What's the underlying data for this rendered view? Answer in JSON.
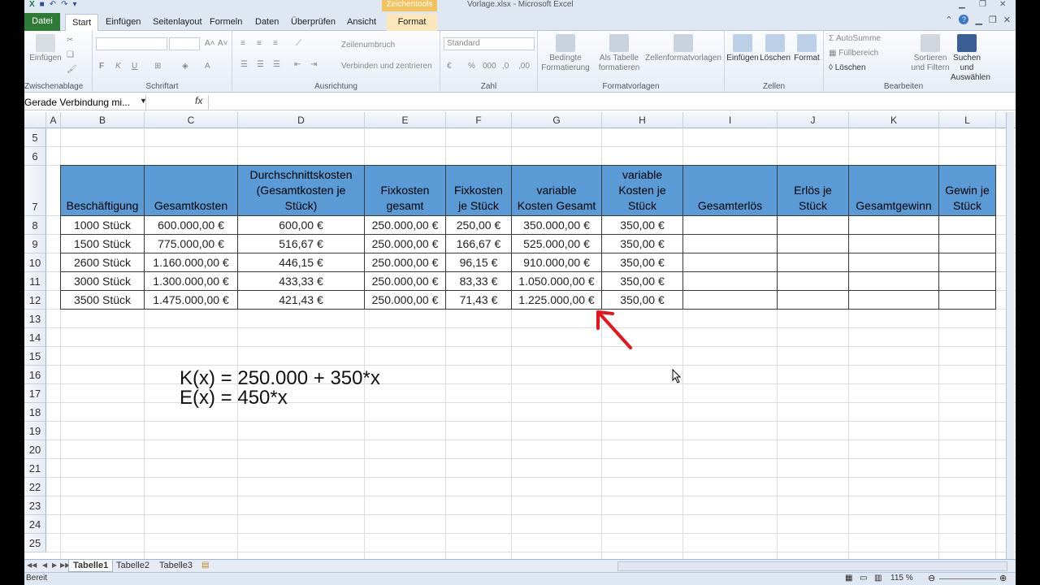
{
  "window": {
    "title": "Vorlage.xlsx - Microsoft Excel",
    "context_tab_group": "Zeichentools"
  },
  "tabs": {
    "file": "Datei",
    "start": "Start",
    "insert": "Einfügen",
    "page_layout": "Seitenlayout",
    "formulas": "Formeln",
    "data": "Daten",
    "review": "Überprüfen",
    "view": "Ansicht",
    "format": "Format"
  },
  "ribbon": {
    "clipboard": {
      "label": "Zwischenablage",
      "paste": "Einfügen"
    },
    "font": {
      "label": "Schriftart",
      "bold": "F",
      "italic": "K",
      "underline": "U"
    },
    "alignment": {
      "label": "Ausrichtung",
      "wrap": "Zeilenumbruch",
      "merge": "Verbinden und zentrieren"
    },
    "number": {
      "label": "Zahl",
      "format": "Standard",
      "percent": "%",
      "thousands": "000"
    },
    "styles": {
      "label": "Formatvorlagen",
      "conditional": "Bedingte Formatierung",
      "as_table": "Als Tabelle formatieren",
      "cell_styles": "Zellenformatvorlagen"
    },
    "cells": {
      "label": "Zellen",
      "insert": "Einfügen",
      "delete": "Löschen",
      "format": "Format"
    },
    "editing": {
      "label": "Bearbeiten",
      "autosum": "AutoSumme",
      "fill": "Füllbereich",
      "clear": "Löschen",
      "sort": "Sortieren und Filtern",
      "find": "Suchen und Auswählen"
    }
  },
  "formula_bar": {
    "name_box": "Gerade Verbindung mi...",
    "fx": "fx",
    "content": ""
  },
  "columns": [
    "A",
    "B",
    "C",
    "D",
    "E",
    "F",
    "G",
    "H",
    "I",
    "J",
    "K",
    "L"
  ],
  "rows": [
    "5",
    "6",
    "7",
    "8",
    "9",
    "10",
    "11",
    "12",
    "13",
    "14",
    "15",
    "16",
    "17",
    "18",
    "19",
    "20",
    "21",
    "22",
    "23",
    "24",
    "25"
  ],
  "table": {
    "headers": [
      "Beschäftigung",
      "Gesamtkosten",
      "Durchschnittskosten\n(Gesamtkosten je\nStück)",
      "Fixkosten\ngesamt",
      "Fixkosten\nje Stück",
      "variable\nKosten Gesamt",
      "variable\nKosten je\nStück",
      "Gesamterlös",
      "Erlös je\nStück",
      "Gesamtgewinn",
      "Gewin je\nStück"
    ],
    "rows": [
      [
        "1000 Stück",
        "600.000,00 €",
        "600,00 €",
        "250.000,00 €",
        "250,00 €",
        "350.000,00 €",
        "350,00 €",
        "",
        "",
        "",
        ""
      ],
      [
        "1500 Stück",
        "775.000,00 €",
        "516,67 €",
        "250.000,00 €",
        "166,67 €",
        "525.000,00 €",
        "350,00 €",
        "",
        "",
        "",
        ""
      ],
      [
        "2600 Stück",
        "1.160.000,00 €",
        "446,15 €",
        "250.000,00 €",
        "96,15 €",
        "910.000,00 €",
        "350,00 €",
        "",
        "",
        "",
        ""
      ],
      [
        "3000 Stück",
        "1.300.000,00 €",
        "433,33 €",
        "250.000,00 €",
        "83,33 €",
        "1.050.000,00 €",
        "350,00 €",
        "",
        "",
        "",
        ""
      ],
      [
        "3500 Stück",
        "1.475.000,00 €",
        "421,43 €",
        "250.000,00 €",
        "71,43 €",
        "1.225.000,00 €",
        "350,00 €",
        "",
        "",
        "",
        ""
      ]
    ]
  },
  "formulas": {
    "cost": "K(x) = 250.000 + 350*x",
    "revenue": "E(x) = 450*x"
  },
  "sheet_tabs": [
    "Tabelle1",
    "Tabelle2",
    "Tabelle3"
  ],
  "status": {
    "ready": "Bereit",
    "zoom": "115 %"
  },
  "colors": {
    "header_fill": "#5b9bd5",
    "arrow": "#e8141c",
    "file_tab": "#2e7b36"
  }
}
